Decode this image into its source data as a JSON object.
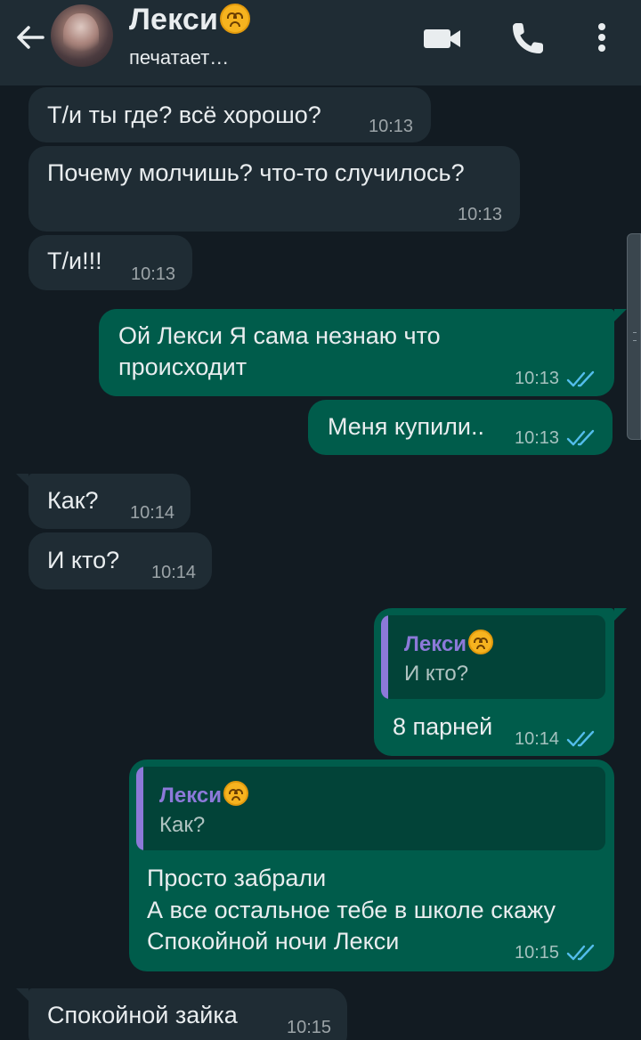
{
  "header": {
    "contact_name": "Лекси",
    "status": "печатает…",
    "icons": [
      "back-arrow-icon",
      "video-call-icon",
      "phone-call-icon",
      "more-options-icon"
    ]
  },
  "colors": {
    "header_bg": "#1f2c34",
    "chat_bg": "#121b22",
    "incoming_bubble": "#1f2c34",
    "outgoing_bubble": "#005c4b",
    "read_ticks": "#53bdeb",
    "quote_name": "#8c79d9"
  },
  "messages": [
    {
      "dir": "in",
      "text": "Т/и ты где? всё хорошо?",
      "time": "10:13"
    },
    {
      "dir": "in",
      "text": "Почему молчишь? что-то случилось?",
      "time": "10:13"
    },
    {
      "dir": "in",
      "text": "Т/и!!!",
      "time": "10:13"
    },
    {
      "dir": "out",
      "lines": [
        "Ой Лекси Я сама незнаю что",
        "происходит"
      ],
      "time": "10:13",
      "read": true
    },
    {
      "dir": "out",
      "text": "Меня купили..",
      "time": "10:13",
      "read": true
    },
    {
      "dir": "in",
      "text": "Как?",
      "time": "10:14"
    },
    {
      "dir": "in",
      "text": "И кто?",
      "time": "10:14"
    },
    {
      "dir": "out",
      "reply": {
        "name": "Лекси",
        "text": "И кто?"
      },
      "text": "8 парней",
      "time": "10:14",
      "read": true
    },
    {
      "dir": "out",
      "reply": {
        "name": "Лекси",
        "text": "Как?"
      },
      "lines": [
        "Просто забрали",
        "А все остальное тебе в школе скажу",
        "Спокойной ночи Лекси"
      ],
      "time": "10:15",
      "read": true
    },
    {
      "dir": "in",
      "text": "Спокойной зайка",
      "time": "10:15"
    }
  ]
}
